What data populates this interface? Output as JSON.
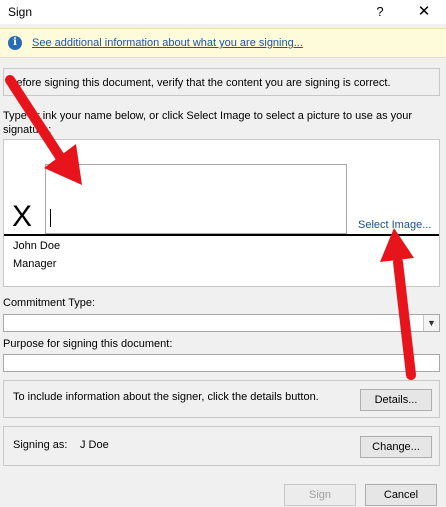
{
  "window": {
    "title": "Sign",
    "help_glyph": "?",
    "close_glyph": "✕"
  },
  "infobar": {
    "icon_glyph": "i",
    "link_text": "See additional information about what you are signing..."
  },
  "verify": {
    "text": "Before signing this document, verify that the content you are signing is correct."
  },
  "signature": {
    "instruction": "Type or ink your name below, or click Select Image to select a picture to use as your signature:",
    "x_mark": "X",
    "select_image_label": "Select Image...",
    "signer_name": "John Doe",
    "signer_title": "Manager",
    "input_value": ""
  },
  "commitment": {
    "label": "Commitment Type:",
    "selected": "",
    "arrow_glyph": "▼"
  },
  "purpose": {
    "label": "Purpose for signing this document:",
    "value": ""
  },
  "details": {
    "text": "To include information about the signer, click the details button.",
    "button_label": "Details..."
  },
  "signing_as": {
    "label": "Signing as:",
    "value": "J Doe",
    "button_label": "Change..."
  },
  "footer": {
    "sign_label": "Sign",
    "cancel_label": "Cancel"
  },
  "colors": {
    "annotation_arrow": "#e8141c",
    "link": "#1a56a8",
    "infobar_bg": "#fdfbd9"
  }
}
